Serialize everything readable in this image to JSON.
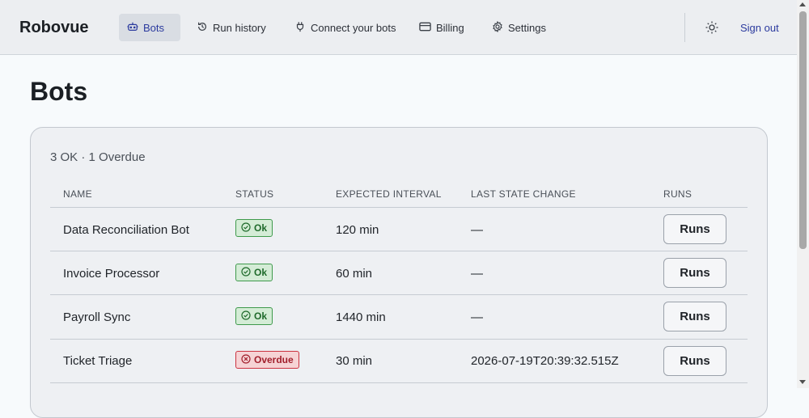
{
  "app": {
    "brand": "Robovue"
  },
  "nav": {
    "items": [
      {
        "label": "Bots",
        "icon": "robot-icon",
        "active": true
      },
      {
        "label": "Run history",
        "icon": "history-icon"
      },
      {
        "label": "Connect your bots",
        "icon": "plug-icon"
      },
      {
        "label": "Billing",
        "icon": "credit-card-icon"
      },
      {
        "label": "Settings",
        "icon": "gear-icon"
      }
    ],
    "theme_icon": "sun-icon",
    "sign_out": "Sign out"
  },
  "page": {
    "title": "Bots"
  },
  "summary": "3 OK · 1 Overdue",
  "table": {
    "columns": [
      "NAME",
      "STATUS",
      "EXPECTED INTERVAL",
      "LAST STATE CHANGE",
      "RUNS"
    ],
    "rows": [
      {
        "name": "Data Reconciliation Bot",
        "status": "Ok",
        "interval": "120 min",
        "last_change": "—",
        "runs": "Runs"
      },
      {
        "name": "Invoice Processor",
        "status": "Ok",
        "interval": "60 min",
        "last_change": "—",
        "runs": "Runs"
      },
      {
        "name": "Payroll Sync",
        "status": "Ok",
        "interval": "1440 min",
        "last_change": "—",
        "runs": "Runs"
      },
      {
        "name": "Ticket Triage",
        "status": "Overdue",
        "interval": "30 min",
        "last_change": "2026-07-19T20:39:32.515Z",
        "runs": "Runs"
      }
    ]
  },
  "colors": {
    "accent": "#2b3a9e",
    "ok": "#3f9a4c",
    "overdue": "#cc3340"
  }
}
